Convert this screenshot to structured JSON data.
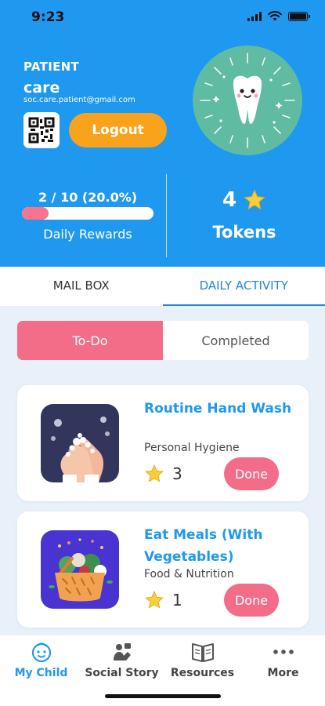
{
  "status": {
    "time": "9:23"
  },
  "profile": {
    "role": "PATIENT",
    "name": "care",
    "email": "soc.care.patient@gmail.com",
    "logout_label": "Logout"
  },
  "rewards": {
    "progress_text": "2 / 10 (20.0%)",
    "progress_fraction": 0.2,
    "label": "Daily Rewards"
  },
  "tokens": {
    "count": "4",
    "label": "Tokens"
  },
  "tabs": [
    {
      "label": "MAIL BOX",
      "active": false
    },
    {
      "label": "DAILY ACTIVITY",
      "active": true
    }
  ],
  "segments": {
    "todo": "To-Do",
    "completed": "Completed",
    "active": "todo"
  },
  "activities": [
    {
      "title": "Routine Hand Wash",
      "category": "Personal Hygiene",
      "stars": "3",
      "action": "Done",
      "icon": "hand-wash-icon"
    },
    {
      "title": "Eat Meals (With Vegetables)",
      "category": "Food & Nutrition",
      "stars": "1",
      "action": "Done",
      "icon": "vegetable-basket-icon"
    }
  ],
  "bottom_nav": [
    {
      "label": "My Child",
      "icon": "child-face-icon",
      "active": true
    },
    {
      "label": "Social Story",
      "icon": "social-story-icon",
      "active": false
    },
    {
      "label": "Resources",
      "icon": "book-icon",
      "active": false
    },
    {
      "label": "More",
      "icon": "more-dots-icon",
      "active": false
    }
  ],
  "colors": {
    "header_blue": "#1f98f0",
    "accent_pink": "#f36c88",
    "logout_orange": "#f9a21b",
    "tooth_bg": "#5fbba1"
  }
}
